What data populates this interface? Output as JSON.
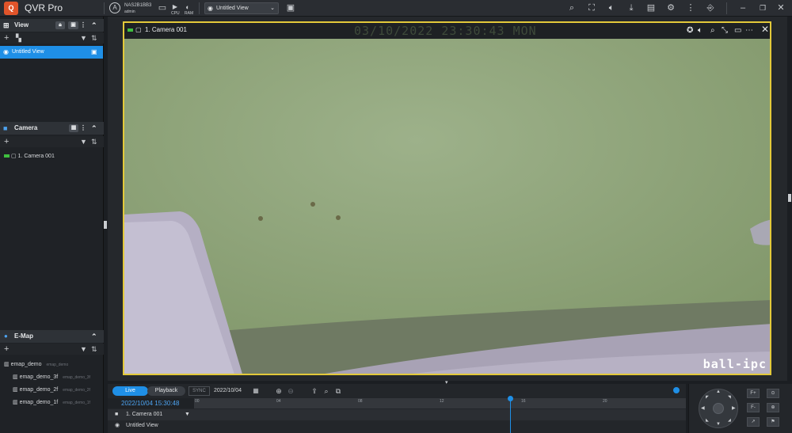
{
  "app": {
    "title": "QVR Pro",
    "logo_icon": "qvr-logo-icon"
  },
  "topbar": {
    "nas_name": "NAS2B1BB3",
    "nas_sub": "admin",
    "cpu_label": "CPU",
    "ram_label": "RAM",
    "view_select": "Untitled View"
  },
  "left": {
    "view": {
      "header": "View",
      "selected_item": "Untitled View"
    },
    "camera": {
      "header": "Camera",
      "items": [
        "1. Camera 001"
      ]
    },
    "emap": {
      "header": "E-Map",
      "root": {
        "label": "emap_demo",
        "sub": "emap_demo"
      },
      "children": [
        {
          "label": "emap_demo_3f",
          "sub": "emap_demo_3f"
        },
        {
          "label": "emap_demo_2f",
          "sub": "emap_demo_2f"
        },
        {
          "label": "emap_demo_1f",
          "sub": "emap_demo_1f"
        }
      ]
    }
  },
  "video": {
    "camera_label": "1. Camera 001",
    "osd_timestamp": "03/10/2022 23:30:43 MON",
    "watermark": "ball-ipc",
    "border_color": "#e3c93a"
  },
  "bottom": {
    "tab_live": "Live",
    "tab_playback": "Playback",
    "sync": "SYNC",
    "date": "2022/10/04",
    "datetime": "2022/10/04 15:30:48",
    "ruler_ticks": [
      "00",
      "04",
      "08",
      "12",
      "16",
      "20"
    ],
    "rows": [
      "1. Camera 001",
      "Untitled View"
    ]
  },
  "colors": {
    "accent": "#1f8fe6",
    "panel": "#1f2226",
    "header": "#2e3237"
  }
}
